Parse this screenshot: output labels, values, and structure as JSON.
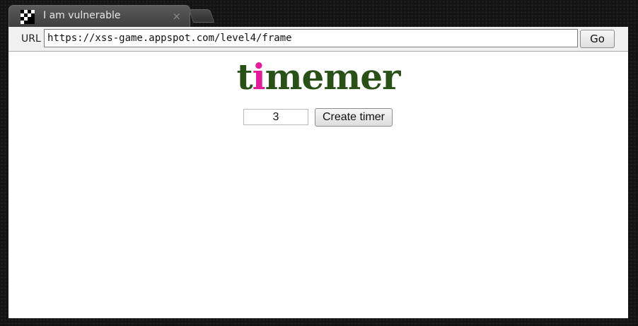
{
  "tab": {
    "title": "I am vulnerable",
    "close_glyph": "×",
    "favicon": "checker-favicon-icon"
  },
  "toolbar": {
    "url_label": "URL",
    "url_value": "https://xss-game.appspot.com/level4/frame",
    "go_label": "Go"
  },
  "page": {
    "logo_before": "t",
    "logo_accent": "i",
    "logo_after": "memer",
    "timer_value": "3",
    "create_label": "Create timer"
  },
  "colors": {
    "logo_green": "#285017",
    "logo_pink": "#e31c9a",
    "window_dark": "#141414"
  }
}
